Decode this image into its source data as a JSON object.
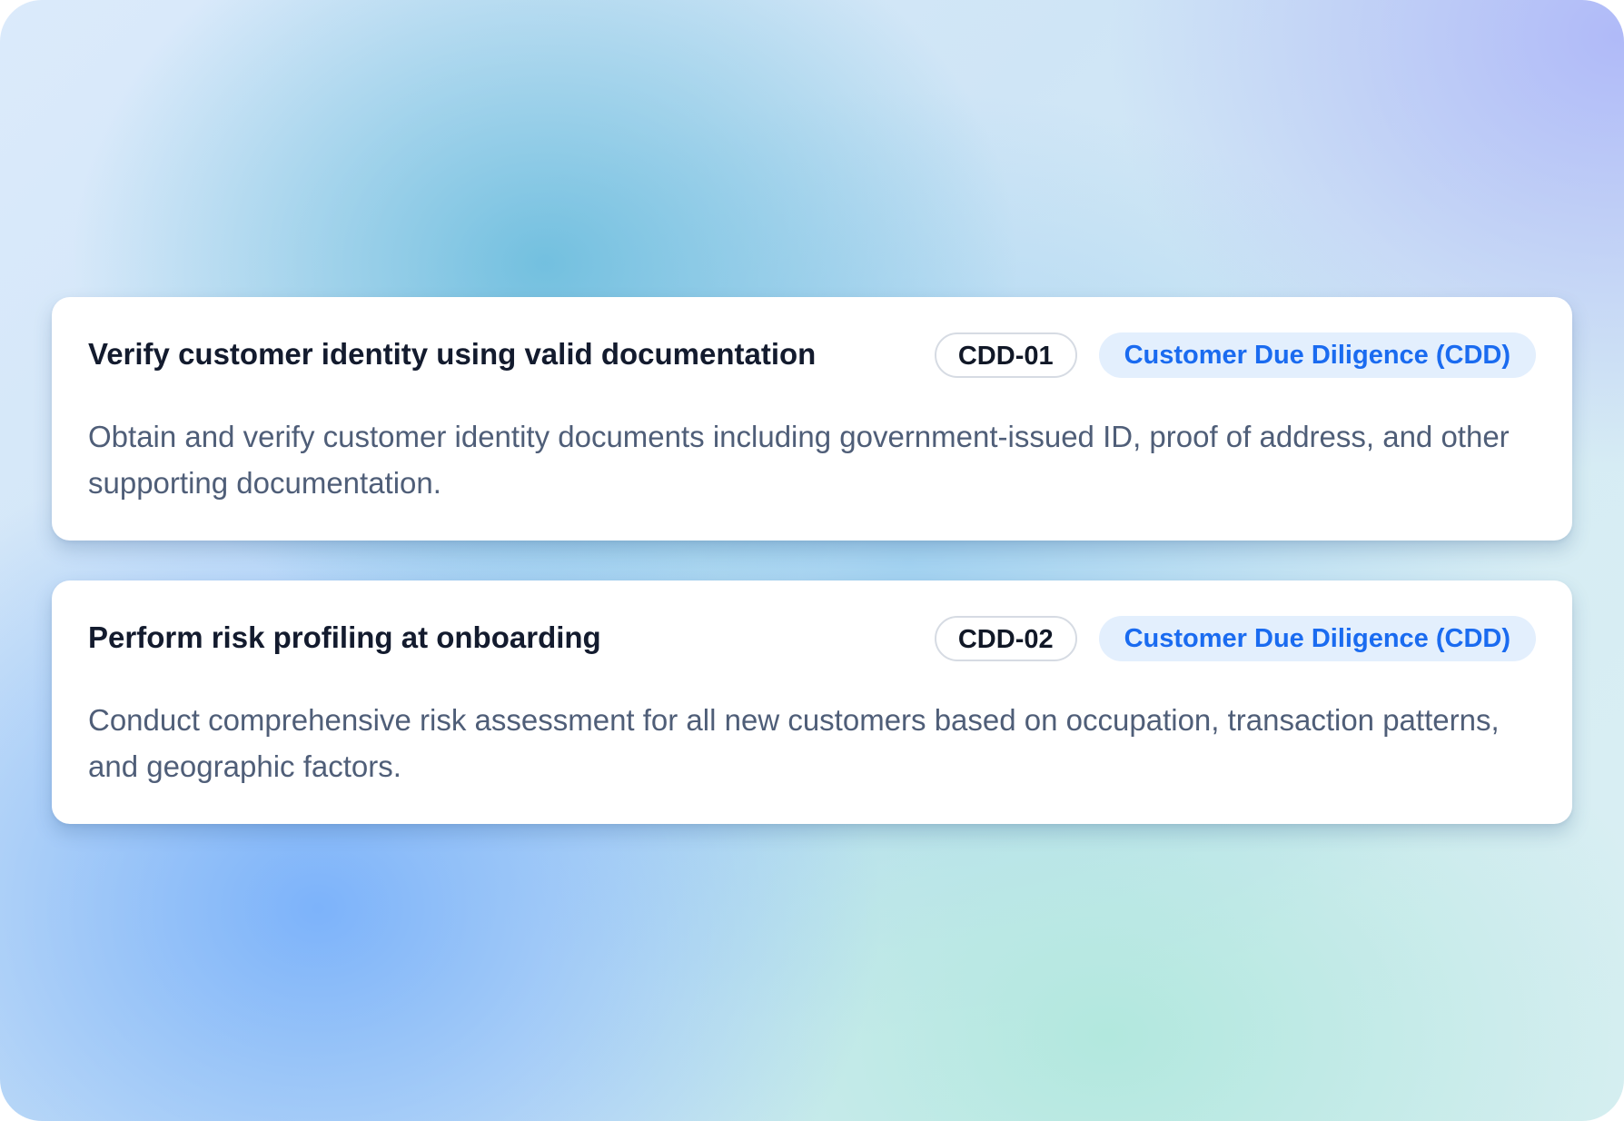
{
  "controls": [
    {
      "title": "Verify customer identity using valid documentation",
      "code": "CDD-01",
      "category": "Customer Due Diligence (CDD)",
      "description": "Obtain and verify customer identity documents including government-issued ID, proof of address, and other supporting documentation."
    },
    {
      "title": "Perform risk profiling at onboarding",
      "code": "CDD-02",
      "category": "Customer Due Diligence (CDD)",
      "description": "Conduct comprehensive risk assessment for all new customers based on occupation, transaction patterns, and geographic factors."
    }
  ],
  "colors": {
    "title_text": "#131b2e",
    "description_text": "#4f5e78",
    "category_text": "#1a6bf0",
    "category_background": "#e3effd",
    "code_border": "#d6dbe3"
  }
}
